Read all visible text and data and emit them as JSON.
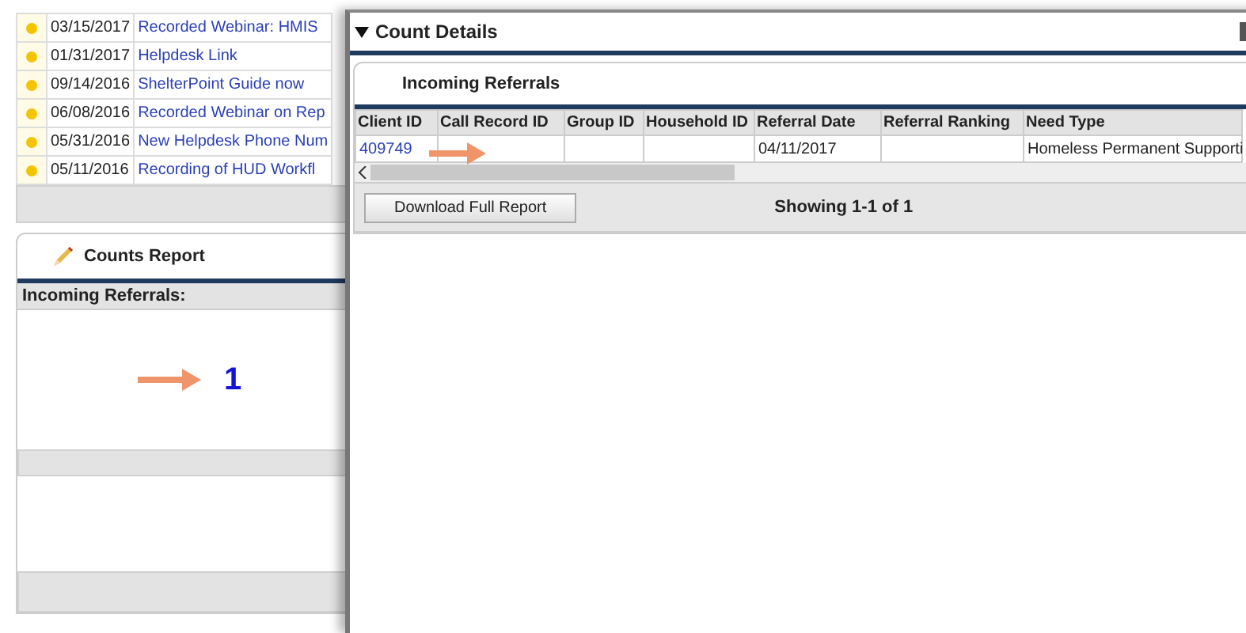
{
  "news": {
    "rows": [
      {
        "date": "03/15/2017",
        "headline": "Recorded Webinar: HMIS"
      },
      {
        "date": "01/31/2017",
        "headline": "Helpdesk Link"
      },
      {
        "date": "09/14/2016",
        "headline": "ShelterPoint Guide now"
      },
      {
        "date": "06/08/2016",
        "headline": "Recorded Webinar on Rep"
      },
      {
        "date": "05/31/2016",
        "headline": "New Helpdesk Phone Num"
      },
      {
        "date": "05/11/2016",
        "headline": "Recording of HUD Workfl"
      }
    ]
  },
  "counts_report": {
    "title": "Counts Report",
    "label": "Incoming Referrals:",
    "count": "1"
  },
  "modal": {
    "title": "Count Details",
    "tab": "Incoming Referrals",
    "columns": [
      "Client ID",
      "Call Record ID",
      "Group ID",
      "Household ID",
      "Referral Date",
      "Referral Ranking",
      "Need Type"
    ],
    "rows": [
      [
        "409749",
        "",
        "",
        "",
        "04/11/2017",
        "",
        "Homeless Permanent Supporti"
      ]
    ],
    "download_button": "Download Full Report",
    "showing": "Showing 1-1 of 1"
  }
}
